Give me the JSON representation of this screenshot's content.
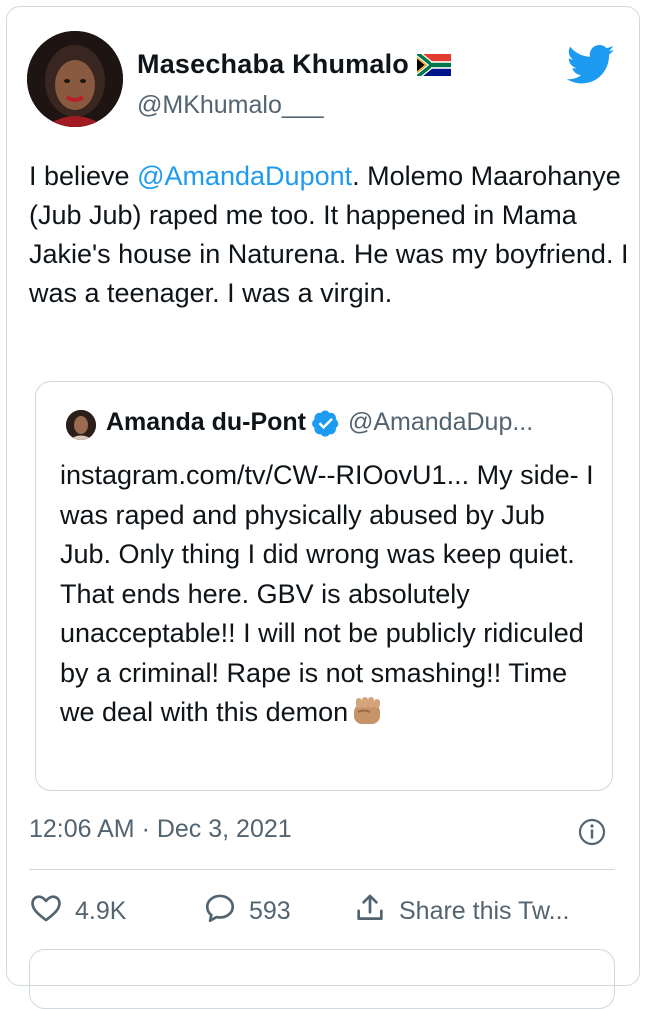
{
  "tweet": {
    "author_name": "Masechaba Khumalo",
    "author_handle": "@MKhumalo___",
    "text_before_mention": "I believe ",
    "mention": "@AmandaDupont",
    "text_after_mention": ". Molemo Maarohanye (Jub Jub) raped me too. It happened in Mama Jakie's house in Naturena. He was my boyfriend. I was a teenager. I was a virgin.",
    "timestamp": "12:06 AM · Dec 3, 2021"
  },
  "quoted_tweet": {
    "author_name": "Amanda du-Pont",
    "author_handle": "@AmandaDup...",
    "text": "instagram.com/tv/CW--RIOovU1... My side- I was raped and physically abused by Jub Jub. Only thing I did wrong was keep quiet. That ends here. GBV is absolutely unacceptable!! I will not be publicly ridiculed by a criminal! Rape is not smashing!! Time we deal with this demon"
  },
  "actions": {
    "like_count": "4.9K",
    "reply_count": "593",
    "share_label": "Share this Tw..."
  },
  "icons": {
    "brand": "twitter-bird-icon",
    "flag": "south-africa-flag-icon",
    "verified": "verified-badge-icon",
    "info": "info-icon",
    "like": "heart-icon",
    "reply": "comment-icon",
    "share": "share-icon",
    "emoji": "raised-fist-medium-skin-tone-icon"
  },
  "colors": {
    "accent": "#1d9bf0",
    "text": "#0f1419",
    "secondary": "#536471",
    "border": "#cfd9de"
  }
}
